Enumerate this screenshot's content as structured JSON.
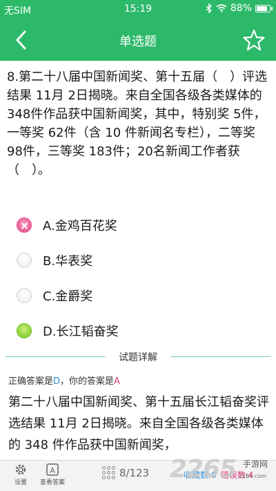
{
  "status_bar": {
    "carrier": "无SIM",
    "time": "15:19",
    "battery": "88%",
    "battery_level": 0.88
  },
  "nav": {
    "title": "单选题",
    "back_icon": "chevron-left-icon",
    "favorite_icon": "star-outline-icon"
  },
  "question": {
    "text": "8.第二十八届中国新闻奖、第十五届（　）评选结果 11月 2日揭晓。来自全国各级各类媒体的 348件作品获中国新闻奖，其中，特别奖 5件，一等奖 62件（含 10 件新闻名专栏），二等奖 98件，三等奖 183件；20名新闻工作者获（　）。"
  },
  "options": [
    {
      "label": "A.金鸡百花奖",
      "state": "wrong"
    },
    {
      "label": "B.华表奖",
      "state": "none"
    },
    {
      "label": "C.金爵奖",
      "state": "none"
    },
    {
      "label": "D.长江韬奋奖",
      "state": "correct"
    }
  ],
  "explanation": {
    "section_title": "试题详解",
    "correct_prefix": "正确答案是",
    "correct_answer": "D",
    "user_prefix": "，你的答案是",
    "user_answer": "A",
    "text": "第二十八届中国新闻奖、第十五届长江韬奋奖评选结果 11月 2日揭晓。来自全国各级各类媒体的 348 件作品获中国新闻奖，"
  },
  "bottom_bar": {
    "settings_label": "设置",
    "view_answer_label": "查看答案",
    "progress": "8/123",
    "favorites_label": "收藏数:0",
    "wrong_label": "错误数:4"
  },
  "watermark": {
    "number": "2265",
    "text_top": "手游网",
    "text_bottom": "2265.com"
  },
  "colors": {
    "accent": "#2db96a",
    "correct_blue": "#2f8fd8",
    "wrong_pink": "#e0407f"
  }
}
